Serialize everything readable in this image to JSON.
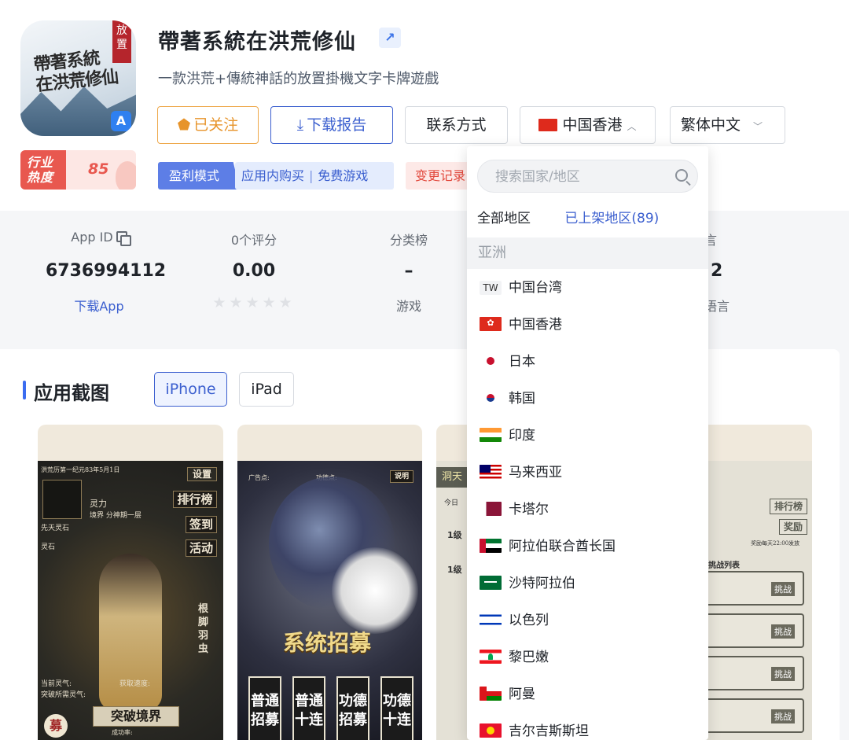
{
  "app": {
    "icon_title_line1": "帶著系統",
    "icon_title_line2": "在洪荒修仙",
    "icon_tag": "放置",
    "title": "帶著系統在洪荒修仙",
    "subtitle": "一款洪荒+傳統神話的放置掛機文字卡牌遊戲",
    "heat_label_line1": "行业",
    "heat_label_line2": "热度",
    "heat_value": "85"
  },
  "actions": {
    "follow_label": "已关注",
    "report_label": "下载报告",
    "contact_label": "联系方式",
    "region_label": "中国香港",
    "language_label": "繁体中文"
  },
  "tags": {
    "mode_label": "盈利模式",
    "mode_values": [
      "应用内购买",
      "免费游戏"
    ],
    "changes_label": "变更记录"
  },
  "stats": {
    "app_id_label": "App ID",
    "app_id_value": "6736994112",
    "download_link": "下载App",
    "rating_label": "0个评分",
    "rating_value": "0.00",
    "rating_stars": 0,
    "category_label": "分类榜",
    "category_value": "–",
    "category_sub": "游戏",
    "lang_label_partial": "语言",
    "lang_value": "2",
    "lang_sub_partial": "门语言"
  },
  "screenshots": {
    "section_title": "应用截图",
    "tabs": [
      "iPhone",
      "iPad"
    ],
    "active_tab": "iPhone",
    "shot1": {
      "header": "洪荒历第一纪元83年5月1日",
      "settings": "设置",
      "rank": "排行榜",
      "checkin": "签到",
      "activity": "活动",
      "lingli": "灵力",
      "realm": "境界 分神期一层",
      "xiantian": "先天灵石",
      "lingshi": "灵石",
      "side_vertical": "根脚羽虫",
      "current_qi": "当前灵气:",
      "gain_speed": "获取速度:",
      "break_need": "突破所需灵气:",
      "break_button": "突破境界",
      "success_rate": "成功率:",
      "recruit_badge": "募"
    },
    "shot2": {
      "ad_points": "广告点:",
      "merit_points": "功德点:",
      "help": "说明",
      "banner": "系统招募",
      "buttons": [
        "普通招募",
        "普通十连",
        "功德招募",
        "功德十连"
      ]
    },
    "shot3": {
      "tab_left": "洞天",
      "today": "今日",
      "level1": "1级",
      "rank": "排行榜",
      "reward": "奖励",
      "reward_note": "奖励每天22:00发放",
      "challenge_list": "挑战列表",
      "challenge": "挑战"
    }
  },
  "region_dropdown": {
    "search_placeholder": "搜索国家/地区",
    "tab_all": "全部地区",
    "tab_listed": "已上架地区(89)",
    "group": "亚洲",
    "items": [
      {
        "code": "TW",
        "flag": "none",
        "name": "中国台湾"
      },
      {
        "code": "",
        "flag": "hk",
        "name": "中国香港"
      },
      {
        "code": "",
        "flag": "jp",
        "name": "日本"
      },
      {
        "code": "",
        "flag": "kr",
        "name": "韩国"
      },
      {
        "code": "",
        "flag": "in",
        "name": "印度"
      },
      {
        "code": "",
        "flag": "my",
        "name": "马来西亚"
      },
      {
        "code": "",
        "flag": "qa",
        "name": "卡塔尔"
      },
      {
        "code": "",
        "flag": "ae",
        "name": "阿拉伯联合酋长国"
      },
      {
        "code": "",
        "flag": "sa",
        "name": "沙特阿拉伯"
      },
      {
        "code": "",
        "flag": "il",
        "name": "以色列"
      },
      {
        "code": "",
        "flag": "lb",
        "name": "黎巴嫩"
      },
      {
        "code": "",
        "flag": "om",
        "name": "阿曼"
      },
      {
        "code": "",
        "flag": "kg",
        "name": "吉尔吉斯斯坦"
      }
    ]
  },
  "colors": {
    "accent_blue": "#3b5fcf",
    "follow_orange": "#e7942b",
    "heat_red": "#e8584f"
  }
}
